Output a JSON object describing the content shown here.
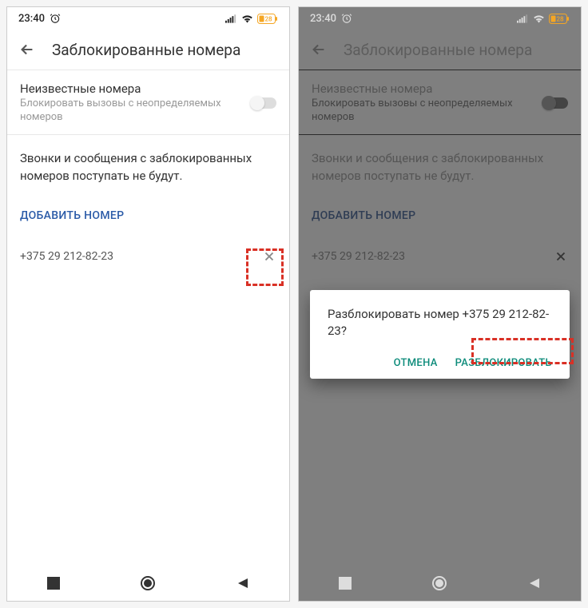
{
  "status": {
    "time": "23:40",
    "battery": "28"
  },
  "header": {
    "title": "Заблокированные номера"
  },
  "unknown_numbers": {
    "title": "Неизвестные номера",
    "subtitle": "Блокировать вызовы с неопределяемых номеров"
  },
  "info_text": "Звонки и сообщения с заблокированных номеров поступать не будут.",
  "add_button": "ДОБАВИТЬ НОМЕР",
  "number": "+375 29 212-82-23",
  "dialog": {
    "text": "Разблокировать номер +375 29 212-82-23?",
    "cancel": "ОТМЕНА",
    "confirm": "РАЗБЛОКИРОВАТЬ"
  }
}
